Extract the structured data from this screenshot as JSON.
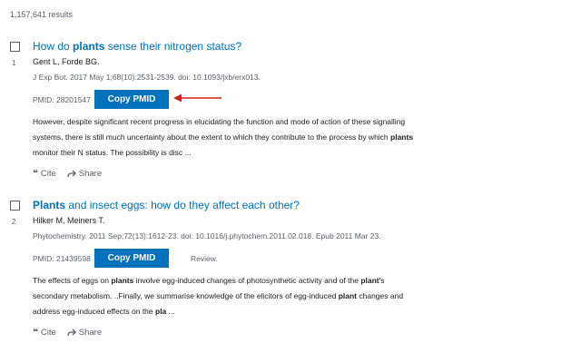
{
  "results_count": "1,157,641 results",
  "colors": {
    "link": "#0071bc",
    "button_bg": "#0071bc",
    "button_text": "#ffffff",
    "muted": "#5b616b",
    "arrow": "#d61f1f"
  },
  "results": [
    {
      "number": "1",
      "title_parts": [
        "How do ",
        "plants",
        " sense their nitrogen status?"
      ],
      "authors": "Gent L, Forde BG.",
      "citation": "J Exp Bot. 2017 May 1;68(10):2531-2539. doi: 10.1093/jxb/erx013.",
      "pmid": "PMID: 28201547",
      "copy_label": "Copy PMID",
      "badge": "",
      "snippet_parts": [
        "However, despite significant recent progress in elucidating the function and mode of action of these signalling systems, there is still much uncertainty about the extent to which they contribute to the process by which ",
        "plants",
        " monitor their N status. The possibility is disc ..."
      ],
      "cite_label": "Cite",
      "share_label": "Share"
    },
    {
      "number": "2",
      "title_parts": [
        "Plants",
        " and insect eggs: how do they affect each other?"
      ],
      "authors": "Hilker M, Meiners T.",
      "citation": "Phytochemistry. 2011 Sep;72(13):1612-23. doi: 10.1016/j.phytochem.2011.02.018. Epub 2011 Mar 23.",
      "pmid": "PMID: 21439598",
      "copy_label": "Copy PMID",
      "badge": "Review.",
      "snippet_parts": [
        "The effects of eggs on ",
        "plants",
        " involve egg-induced changes of photosynthetic activity and of the ",
        "plant",
        "'s secondary metabolism. ..Finally, we summarise knowledge of the elicitors of egg-induced ",
        "plant",
        " changes and address egg-induced effects on the ",
        "pla",
        " ..."
      ],
      "cite_label": "Cite",
      "share_label": "Share"
    }
  ]
}
